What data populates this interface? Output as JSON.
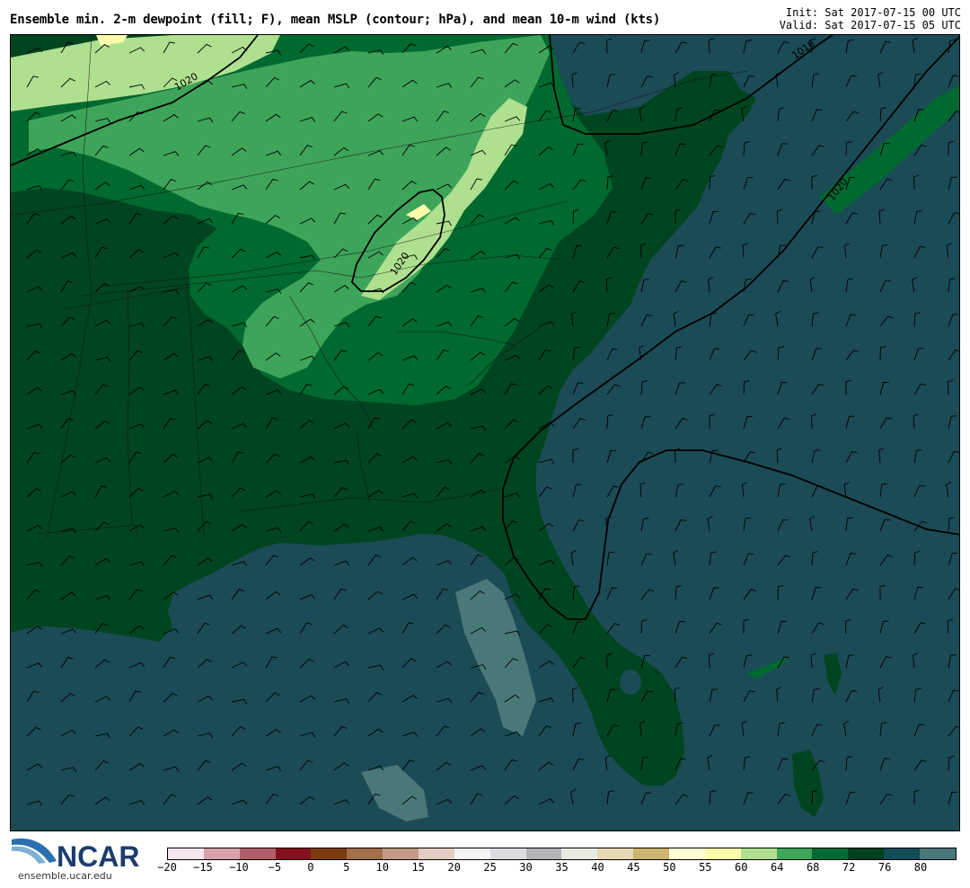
{
  "title": "Ensemble min. 2-m dewpoint (fill; F), mean MSLP (contour; hPa), and mean 10-m wind (kts)",
  "init": "Init: Sat 2017-07-15 00 UTC",
  "valid": "Valid: Sat 2017-07-15 05 UTC",
  "logo": {
    "name": "NCAR",
    "url": "ensemble.ucar.edu"
  },
  "colorbar": {
    "colors": [
      "#f7e6ee",
      "#d8a2ad",
      "#b15e6a",
      "#86101f",
      "#7a3b0e",
      "#a3704d",
      "#c49b86",
      "#e2cfc2",
      "#f4f5f6",
      "#dcdde0",
      "#b3b5b8",
      "#eaebe2",
      "#e5dab3",
      "#cdb571",
      "#fefed6",
      "#fbfcab",
      "#aee090",
      "#3fa55a",
      "#006b35",
      "#00401f",
      "#124c55",
      "#4a7878"
    ],
    "ticks": [
      "−20",
      "−15",
      "−10",
      "−5",
      "0",
      "5",
      "10",
      "15",
      "20",
      "25",
      "30",
      "35",
      "40",
      "45",
      "50",
      "55",
      "60",
      "64",
      "68",
      "72",
      "76",
      "80"
    ]
  },
  "contour_labels": [
    "1020",
    "1020",
    "1020",
    "1016"
  ],
  "map_colors": {
    "ocean": "#1b4b55",
    "dewpoint_72_76": "#004520",
    "dewpoint_68_72": "#00692f",
    "dewpoint_64_68": "#3ea459",
    "dewpoint_60_64": "#aee090",
    "dewpoint_55_60": "#fbfcab",
    "ocean_light": "#4a7878"
  }
}
